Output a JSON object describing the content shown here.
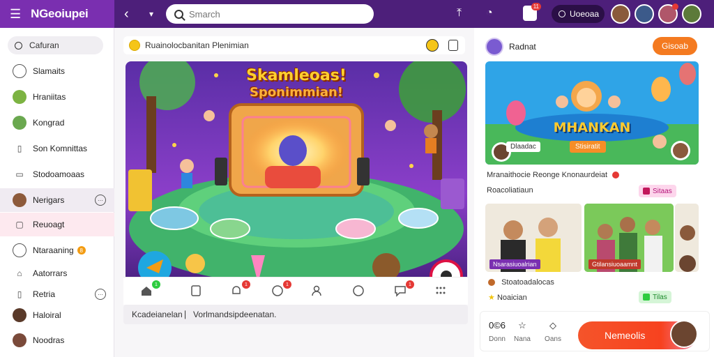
{
  "app": {
    "name": "NGeoiupei"
  },
  "search": {
    "placeholder": "Smarch",
    "right_label": "Uoeoaa"
  },
  "topbar": {
    "notif_badge": "11"
  },
  "sidebar": {
    "search_label": "Cafuran",
    "items": [
      {
        "label": "Slamaits",
        "icon": "circle-icon"
      },
      {
        "label": "Hraniitas",
        "icon": "avatar-icon"
      },
      {
        "label": "Kongrad",
        "icon": "avatar-icon"
      },
      {
        "label": "Son Komnittas",
        "icon": "bookmark-icon"
      },
      {
        "label": "Stodoamoaas",
        "icon": "card-icon"
      },
      {
        "label": "Nerigars",
        "icon": "avatar-icon"
      },
      {
        "label": "Reuoagt",
        "icon": "square-icon"
      },
      {
        "label": "Ntaraaning",
        "icon": "circle-icon",
        "badge": "8"
      },
      {
        "label": "Aatorrars",
        "icon": "home-icon"
      },
      {
        "label": "Retria",
        "icon": "bookmark-icon"
      },
      {
        "label": "Haloiral",
        "icon": "avatar-icon"
      },
      {
        "label": "Noodras",
        "icon": "avatar-icon"
      }
    ]
  },
  "center": {
    "breadcrumb": "Ruainolocbanitan Plenimian",
    "hero": {
      "title_line1": "Skamleoas!",
      "title_line2": "Sponimmian!"
    },
    "bar_badges": [
      "1",
      "1",
      "1",
      "1",
      "1"
    ],
    "caption": "Kcadeianelan ⎸Vorlmandsipdeenatan."
  },
  "right": {
    "header": "Radnat",
    "header_button": "Gisoab",
    "banner": {
      "title": "MHANKAN",
      "label": "Dlaadac",
      "tag": "Stisiratit"
    },
    "line1": "Mranaithocie Reonge Knonaurdeiat",
    "line2": "Roacoliatiaun",
    "pill1": "Sitaas",
    "photo1_label": "Nsarasiuoalrian",
    "photo2_label": "Gtilansiuoaamnt",
    "line3": "Stoatoadalocas",
    "line4": "Noaician",
    "pill2": "Tilas",
    "footer": {
      "stat1_value": "0©6",
      "stat1_label": "Donn",
      "stat2_label": "Nana",
      "stat3_label": "Oans",
      "button_label": "Nemeolis"
    }
  },
  "colors": {
    "topbar": "#4d1f7a",
    "brand": "#7a2fb0",
    "accent": "#f47a20",
    "cta": "#f5542a"
  }
}
